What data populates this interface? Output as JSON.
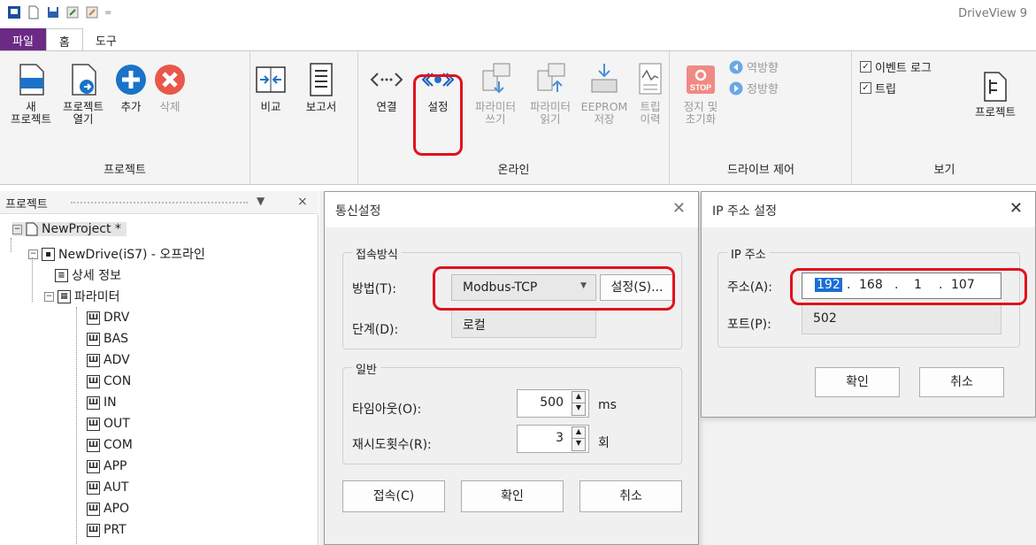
{
  "app": {
    "title": "DriveView 9"
  },
  "tabs": [
    "파일",
    "홈",
    "도구"
  ],
  "ribbon": {
    "project": {
      "label": "프로젝트",
      "new1": "새",
      "new2": "프로젝트",
      "open1": "프로젝트",
      "open2": "열기",
      "add": "추가",
      "delete": "삭제",
      "compare": "비교",
      "report": "보고서"
    },
    "online": {
      "label": "온라인",
      "connect": "연결",
      "settings": "설정",
      "paramwrite1": "파라미터",
      "paramwrite2": "쓰기",
      "paramread1": "파라미터",
      "paramread2": "읽기",
      "eeprom1": "EEPROM",
      "eeprom2": "저장",
      "trip1": "트립",
      "trip2": "이력"
    },
    "drive": {
      "label": "드라이브 제어",
      "stop1": "정지 및",
      "stop2": "초기화",
      "stop_icon_text": "STOP",
      "reverse": "역방향",
      "forward": "정방향"
    },
    "view": {
      "label": "보기",
      "eventlog": "이벤트 로그",
      "trip": "트립",
      "project": "프로젝트"
    }
  },
  "panel": {
    "title": "프로젝트",
    "pin": "ᅟ",
    "close": "×"
  },
  "tree": {
    "root": "NewProject *",
    "drive": "NewDrive(iS7) - 오프라인",
    "detail": "상세 정보",
    "params": "파라미터",
    "groups": [
      "DRV",
      "BAS",
      "ADV",
      "CON",
      "IN",
      "OUT",
      "COM",
      "APP",
      "AUT",
      "APO",
      "PRT"
    ]
  },
  "comm_dialog": {
    "title": "통신설정",
    "section_conn": "접속방식",
    "method_label": "방법(T):",
    "method_value": "Modbus-TCP",
    "settings_button": "설정(S)...",
    "stage_label": "단계(D):",
    "stage_value": "로컬",
    "section_general": "일반",
    "timeout_label": "타임아웃(O):",
    "timeout_value": "500",
    "timeout_unit": "ms",
    "retry_label": "재시도횟수(R):",
    "retry_value": "3",
    "retry_unit": "회",
    "connect_button": "접속(C)",
    "ok_button": "확인",
    "cancel_button": "취소"
  },
  "ip_dialog": {
    "title": "IP 주소 설정",
    "section": "IP 주소",
    "address_label": "주소(A):",
    "ip": [
      "192",
      "168",
      "1",
      "107"
    ],
    "port_label": "포트(P):",
    "port_value": "502",
    "ok_button": "확인",
    "cancel_button": "취소"
  },
  "colors": {
    "file_tab": "#6b2a84",
    "highlight": "#e0121b",
    "accent_blue": "#1a73c8",
    "delete_red": "#e8574a"
  }
}
